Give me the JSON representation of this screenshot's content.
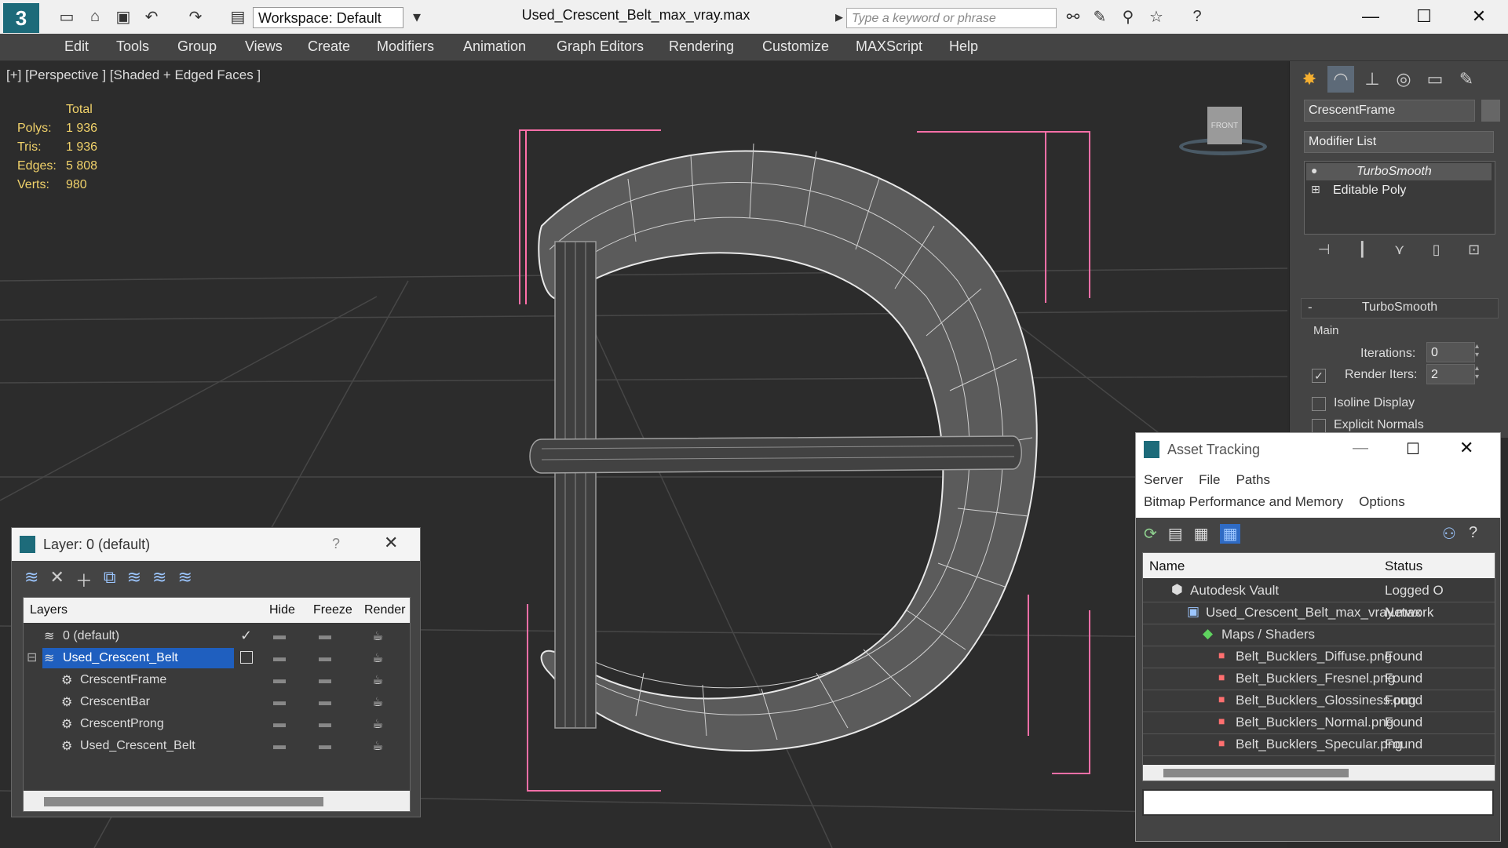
{
  "window": {
    "title": "Used_Crescent_Belt_max_vray.max",
    "workspace": "Workspace: Default",
    "search_placeholder": "Type a keyword or phrase"
  },
  "menu": [
    "Edit",
    "Tools",
    "Group",
    "Views",
    "Create",
    "Modifiers",
    "Animation",
    "Graph Editors",
    "Rendering",
    "Customize",
    "MAXScript",
    "Help"
  ],
  "viewport": {
    "label": "[+] [Perspective ] [Shaded + Edged Faces ]",
    "stats_header": "Total",
    "stats": [
      {
        "label": "Polys:",
        "value": "1 936"
      },
      {
        "label": "Tris:",
        "value": "1 936"
      },
      {
        "label": "Edges:",
        "value": "5 808"
      },
      {
        "label": "Verts:",
        "value": "980"
      }
    ],
    "viewcube_label": "FRONT"
  },
  "command_panel": {
    "object_name": "CrescentFrame",
    "modifier_list": "Modifier List",
    "stack": [
      "TurboSmooth",
      "Editable Poly"
    ],
    "rollout_title": "TurboSmooth",
    "group_main": "Main",
    "iterations_label": "Iterations:",
    "iterations_value": "0",
    "render_iters_label": "Render Iters:",
    "render_iters_value": "2",
    "isoline_label": "Isoline Display",
    "explicit_label": "Explicit Normals"
  },
  "layer_dialog": {
    "title": "Layer: 0 (default)",
    "help": "?",
    "columns": [
      "Layers",
      "Hide",
      "Freeze",
      "Render"
    ],
    "rows": [
      {
        "name": "0 (default)",
        "indent": 1
      },
      {
        "name": "Used_Crescent_Belt",
        "indent": 1
      },
      {
        "name": "CrescentFrame",
        "indent": 2
      },
      {
        "name": "CrescentBar",
        "indent": 2
      },
      {
        "name": "CrescentProng",
        "indent": 2
      },
      {
        "name": "Used_Crescent_Belt",
        "indent": 2
      }
    ]
  },
  "asset_dialog": {
    "title": "Asset Tracking",
    "menu1": [
      "Server",
      "File",
      "Paths"
    ],
    "menu2": [
      "Bitmap Performance and Memory",
      "Options"
    ],
    "columns": [
      "Name",
      "Status"
    ],
    "rows": [
      {
        "name": "Autodesk Vault",
        "status": "Logged O",
        "indent": 1
      },
      {
        "name": "Used_Crescent_Belt_max_vray.max",
        "status": "Network",
        "indent": 2
      },
      {
        "name": "Maps / Shaders",
        "status": "",
        "indent": 3
      },
      {
        "name": "Belt_Bucklers_Diffuse.png",
        "status": "Found",
        "indent": 4
      },
      {
        "name": "Belt_Bucklers_Fresnel.png",
        "status": "Found",
        "indent": 4
      },
      {
        "name": "Belt_Bucklers_Glossiness.png",
        "status": "Found",
        "indent": 4
      },
      {
        "name": "Belt_Bucklers_Normal.png",
        "status": "Found",
        "indent": 4
      },
      {
        "name": "Belt_Bucklers_Specular.png",
        "status": "Found",
        "indent": 4
      }
    ]
  },
  "colors": {
    "selection_blue": "#1f5fbf",
    "bbox_pink": "#ff6fa8",
    "stats_yellow": "#f1d26a"
  }
}
